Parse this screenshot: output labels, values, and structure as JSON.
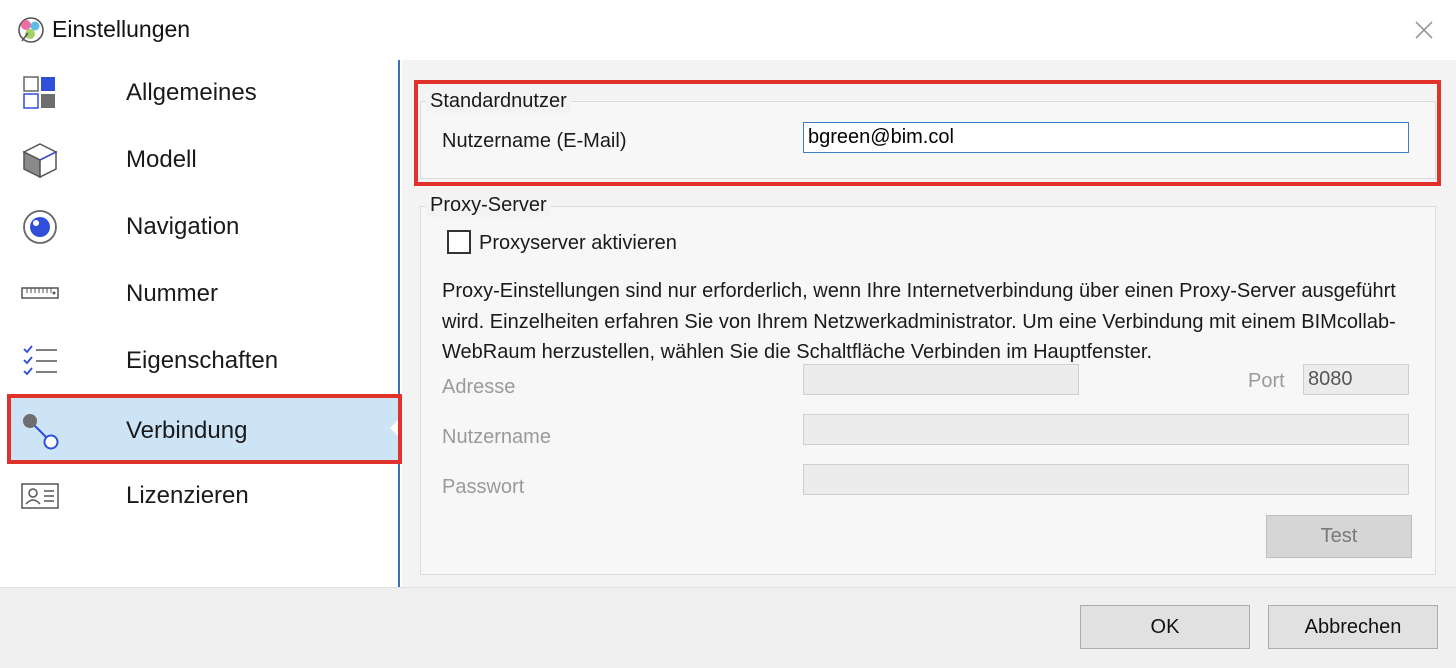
{
  "window": {
    "title": "Einstellungen"
  },
  "sidebar": {
    "items": [
      {
        "label": "Allgemeines",
        "icon": "grid-icon"
      },
      {
        "label": "Modell",
        "icon": "cube-icon"
      },
      {
        "label": "Navigation",
        "icon": "eye-icon"
      },
      {
        "label": "Nummer",
        "icon": "ruler-icon"
      },
      {
        "label": "Eigenschaften",
        "icon": "checklist-icon"
      },
      {
        "label": "Verbindung",
        "icon": "connection-icon",
        "active": true
      },
      {
        "label": "Lizenzieren",
        "icon": "id-card-icon"
      }
    ]
  },
  "standard_user": {
    "group_title": "Standardnutzer",
    "username_label": "Nutzername (E-Mail)",
    "username_value": "bgreen@bim.col"
  },
  "proxy": {
    "group_title": "Proxy-Server",
    "enable_label": "Proxyserver aktivieren",
    "enabled": false,
    "description": "Proxy-Einstellungen sind nur erforderlich, wenn Ihre Internetverbindung über einen Proxy-Server ausgeführt wird. Einzelheiten erfahren Sie von Ihrem Netzwerkadministrator. Um eine Verbindung mit einem BIMcollab-WebRaum herzustellen, wählen Sie die Schaltfläche Verbinden im Hauptfenster.",
    "address_label": "Adresse",
    "address_value": "",
    "port_label": "Port",
    "port_value": "8080",
    "username_label": "Nutzername",
    "username_value": "",
    "password_label": "Passwort",
    "password_value": "",
    "test_label": "Test"
  },
  "footer": {
    "ok_label": "OK",
    "cancel_label": "Abbrechen"
  },
  "colors": {
    "highlight": "#e0312b",
    "active_bg": "#cde4f7",
    "accent": "#3b6fb6",
    "icon_blue": "#2f4fd8"
  }
}
